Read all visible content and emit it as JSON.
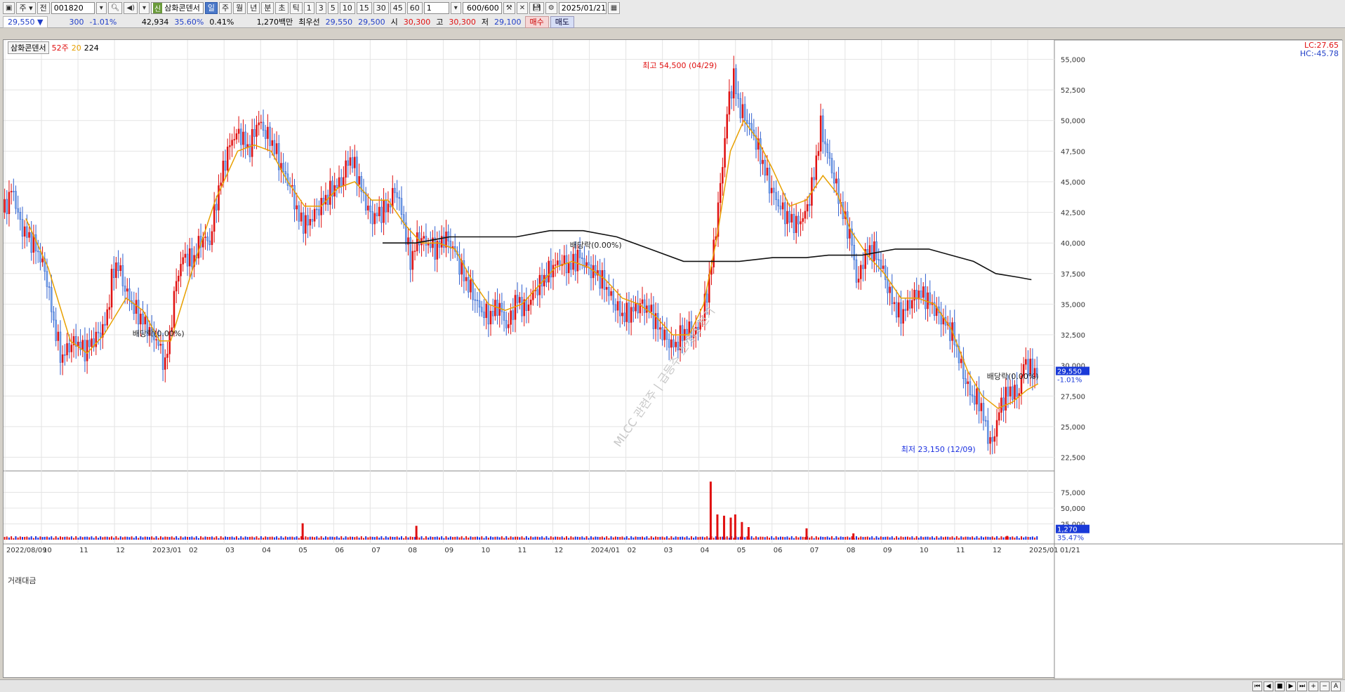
{
  "toolbar": {
    "period_label": "주",
    "prev_label": "전",
    "stock_code": "001820",
    "stock_badge": "신",
    "stock_name": "삼화콘덴서",
    "period_tabs": [
      "일",
      "주",
      "월",
      "년",
      "분",
      "초",
      "틱"
    ],
    "interval_buttons": [
      "1",
      "3",
      "5",
      "10",
      "15",
      "30",
      "45",
      "60"
    ],
    "units_value": "1",
    "count_value": "600/600",
    "date_value": "2025/01/21"
  },
  "quote": {
    "price": "29,550",
    "change_arrow": "▼",
    "change": "300",
    "change_pct": "-1.01%",
    "volume": "42,934",
    "volume_pct": "35.60%",
    "turnover_pct": "0.41%",
    "amount": "1,270백만",
    "best_bid_label": "최우선",
    "best_ask": "29,550",
    "best_bid": "29,500",
    "open_label": "시",
    "open": "30,300",
    "high_label": "고",
    "high": "30,300",
    "low_label": "저",
    "low": "29,100",
    "buy_label": "매수",
    "sell_label": "매도"
  },
  "legend": {
    "title": "삼화콘덴서",
    "ma1": "52주",
    "ma2": "20",
    "ma3": "224",
    "volume_title": "거래대금"
  },
  "corner": {
    "lc": "LC:27.65",
    "hc": "HC:-45.78"
  },
  "watermark": "MLCC 관련주 | 급등주 스캐너 전기",
  "chart_data": {
    "type": "candlestick",
    "title": "삼화콘덴서",
    "price_axis_ticks": [
      "55,000",
      "52,500",
      "50,000",
      "47,500",
      "45,000",
      "42,500",
      "40,000",
      "37,500",
      "35,000",
      "32,500",
      "30,000",
      "27,500",
      "25,000",
      "22,500"
    ],
    "price_axis_values": [
      55000,
      52500,
      50000,
      47500,
      45000,
      42500,
      40000,
      37500,
      35000,
      32500,
      30000,
      27500,
      25000,
      22500
    ],
    "volume_axis_ticks": [
      "75,000",
      "50,000",
      "25,000"
    ],
    "volume_axis_values": [
      75000,
      50000,
      25000
    ],
    "x_axis_labels": [
      "2022/08/09",
      "10",
      "11",
      "12",
      "2023/01",
      "02",
      "03",
      "04",
      "05",
      "06",
      "07",
      "08",
      "09",
      "10",
      "11",
      "12",
      "2024/01",
      "02",
      "03",
      "04",
      "05",
      "06",
      "07",
      "08",
      "09",
      "10",
      "11",
      "12",
      "2025/01",
      "01/21"
    ],
    "current_price_label": "29,550",
    "current_change_label": "-1.01%",
    "volume_current_label": "1,270",
    "volume_pct_label": "35.47%",
    "high_annotation": "최고 54,500 (04/29)",
    "low_annotation": "최저 23,150 (12/09)",
    "dividend_annotations": [
      "배당락(0.00%)",
      "배당락(0.00%)",
      "배당락(0.00%)"
    ],
    "ylim": [
      21500,
      56000
    ],
    "close_path": [
      [
        0,
        42500
      ],
      [
        8,
        44500
      ],
      [
        15,
        41500
      ],
      [
        22,
        40500
      ],
      [
        30,
        39500
      ],
      [
        38,
        37500
      ],
      [
        45,
        33500
      ],
      [
        52,
        30500
      ],
      [
        58,
        31500
      ],
      [
        65,
        32000
      ],
      [
        72,
        31200
      ],
      [
        78,
        31800
      ],
      [
        85,
        32500
      ],
      [
        92,
        33500
      ],
      [
        97,
        37000
      ],
      [
        102,
        38500
      ],
      [
        108,
        36500
      ],
      [
        115,
        35000
      ],
      [
        122,
        34000
      ],
      [
        130,
        33000
      ],
      [
        138,
        32000
      ],
      [
        145,
        30000
      ],
      [
        150,
        33000
      ],
      [
        155,
        37000
      ],
      [
        162,
        39000
      ],
      [
        170,
        38500
      ],
      [
        178,
        40500
      ],
      [
        185,
        40000
      ],
      [
        190,
        43000
      ],
      [
        198,
        46500
      ],
      [
        205,
        48500
      ],
      [
        212,
        49000
      ],
      [
        220,
        47500
      ],
      [
        228,
        50000
      ],
      [
        235,
        49000
      ],
      [
        242,
        48000
      ],
      [
        250,
        46000
      ],
      [
        258,
        44500
      ],
      [
        265,
        42000
      ],
      [
        272,
        41500
      ],
      [
        280,
        42500
      ],
      [
        288,
        43500
      ],
      [
        296,
        44500
      ],
      [
        303,
        45000
      ],
      [
        310,
        47000
      ],
      [
        316,
        46000
      ],
      [
        322,
        44000
      ],
      [
        330,
        42000
      ],
      [
        338,
        42500
      ],
      [
        345,
        43000
      ],
      [
        352,
        44500
      ],
      [
        358,
        42000
      ],
      [
        365,
        38500
      ],
      [
        372,
        40500
      ],
      [
        380,
        40000
      ],
      [
        388,
        39500
      ],
      [
        396,
        40500
      ],
      [
        404,
        39500
      ],
      [
        412,
        37500
      ],
      [
        420,
        36000
      ],
      [
        428,
        34500
      ],
      [
        436,
        34000
      ],
      [
        444,
        35000
      ],
      [
        452,
        33000
      ],
      [
        460,
        35500
      ],
      [
        468,
        34500
      ],
      [
        476,
        36000
      ],
      [
        484,
        37000
      ],
      [
        492,
        38000
      ],
      [
        500,
        38500
      ],
      [
        508,
        38000
      ],
      [
        516,
        39000
      ],
      [
        524,
        38000
      ],
      [
        532,
        37500
      ],
      [
        540,
        36500
      ],
      [
        548,
        35000
      ],
      [
        556,
        34000
      ],
      [
        564,
        34500
      ],
      [
        572,
        35000
      ],
      [
        580,
        34500
      ],
      [
        588,
        33000
      ],
      [
        596,
        32000
      ],
      [
        602,
        31500
      ],
      [
        608,
        32500
      ],
      [
        614,
        33000
      ],
      [
        620,
        32500
      ],
      [
        627,
        34000
      ],
      [
        634,
        37500
      ],
      [
        640,
        42000
      ],
      [
        645,
        46500
      ],
      [
        650,
        51500
      ],
      [
        655,
        53500
      ],
      [
        660,
        51000
      ],
      [
        667,
        50000
      ],
      [
        674,
        48500
      ],
      [
        681,
        46500
      ],
      [
        688,
        44500
      ],
      [
        696,
        43000
      ],
      [
        704,
        42000
      ],
      [
        712,
        41500
      ],
      [
        720,
        42500
      ],
      [
        727,
        45500
      ],
      [
        733,
        49500
      ],
      [
        740,
        47000
      ],
      [
        747,
        44500
      ],
      [
        754,
        42000
      ],
      [
        760,
        40500
      ],
      [
        766,
        36500
      ],
      [
        772,
        39000
      ],
      [
        780,
        39500
      ],
      [
        788,
        38000
      ],
      [
        796,
        35500
      ],
      [
        804,
        34000
      ],
      [
        812,
        35000
      ],
      [
        820,
        36000
      ],
      [
        828,
        35500
      ],
      [
        836,
        34500
      ],
      [
        844,
        33500
      ],
      [
        852,
        32500
      ],
      [
        860,
        29500
      ],
      [
        868,
        27500
      ],
      [
        876,
        27000
      ],
      [
        882,
        24500
      ],
      [
        887,
        23500
      ],
      [
        892,
        26000
      ],
      [
        898,
        27500
      ],
      [
        904,
        28000
      ],
      [
        910,
        27500
      ],
      [
        916,
        30500
      ],
      [
        922,
        29500
      ],
      [
        928,
        29550
      ]
    ],
    "ma20_path": [
      [
        20,
        42000
      ],
      [
        40,
        38000
      ],
      [
        60,
        32000
      ],
      [
        75,
        31000
      ],
      [
        90,
        32500
      ],
      [
        110,
        35500
      ],
      [
        125,
        34500
      ],
      [
        140,
        32000
      ],
      [
        150,
        32000
      ],
      [
        170,
        38000
      ],
      [
        190,
        43500
      ],
      [
        210,
        47500
      ],
      [
        225,
        48000
      ],
      [
        240,
        47500
      ],
      [
        255,
        45000
      ],
      [
        270,
        43000
      ],
      [
        285,
        43000
      ],
      [
        300,
        44500
      ],
      [
        315,
        45000
      ],
      [
        330,
        43500
      ],
      [
        345,
        43500
      ],
      [
        360,
        41500
      ],
      [
        375,
        40000
      ],
      [
        390,
        40000
      ],
      [
        405,
        39500
      ],
      [
        420,
        37000
      ],
      [
        435,
        35000
      ],
      [
        450,
        34500
      ],
      [
        465,
        35000
      ],
      [
        480,
        36500
      ],
      [
        495,
        38000
      ],
      [
        510,
        38500
      ],
      [
        525,
        38000
      ],
      [
        540,
        37000
      ],
      [
        555,
        35500
      ],
      [
        570,
        35000
      ],
      [
        585,
        34000
      ],
      [
        600,
        32500
      ],
      [
        615,
        32500
      ],
      [
        628,
        35000
      ],
      [
        640,
        40500
      ],
      [
        652,
        47500
      ],
      [
        664,
        50000
      ],
      [
        676,
        48500
      ],
      [
        690,
        46000
      ],
      [
        705,
        43000
      ],
      [
        720,
        43500
      ],
      [
        735,
        45500
      ],
      [
        748,
        44000
      ],
      [
        760,
        41000
      ],
      [
        775,
        39000
      ],
      [
        790,
        37500
      ],
      [
        805,
        35500
      ],
      [
        820,
        35500
      ],
      [
        835,
        35000
      ],
      [
        850,
        33000
      ],
      [
        865,
        29500
      ],
      [
        878,
        27500
      ],
      [
        892,
        26500
      ],
      [
        905,
        27000
      ],
      [
        918,
        28000
      ],
      [
        928,
        28500
      ]
    ],
    "ma224_path": [
      [
        340,
        40000
      ],
      [
        370,
        40000
      ],
      [
        400,
        40500
      ],
      [
        430,
        40500
      ],
      [
        460,
        40500
      ],
      [
        490,
        41000
      ],
      [
        520,
        41000
      ],
      [
        550,
        40500
      ],
      [
        580,
        39500
      ],
      [
        610,
        38500
      ],
      [
        625,
        38500
      ],
      [
        640,
        38500
      ],
      [
        660,
        38500
      ],
      [
        690,
        38800
      ],
      [
        720,
        38800
      ],
      [
        740,
        39000
      ],
      [
        770,
        39000
      ],
      [
        800,
        39500
      ],
      [
        830,
        39500
      ],
      [
        850,
        39000
      ],
      [
        870,
        38500
      ],
      [
        890,
        37500
      ],
      [
        910,
        37200
      ],
      [
        922,
        37000
      ]
    ],
    "volume_spikes": [
      [
        268,
        26000
      ],
      [
        370,
        22000
      ],
      [
        634,
        92000
      ],
      [
        640,
        40000
      ],
      [
        646,
        38000
      ],
      [
        652,
        35000
      ],
      [
        656,
        40000
      ],
      [
        662,
        28000
      ],
      [
        668,
        20000
      ],
      [
        720,
        18000
      ],
      [
        762,
        10000
      ],
      [
        900,
        6000
      ]
    ]
  }
}
